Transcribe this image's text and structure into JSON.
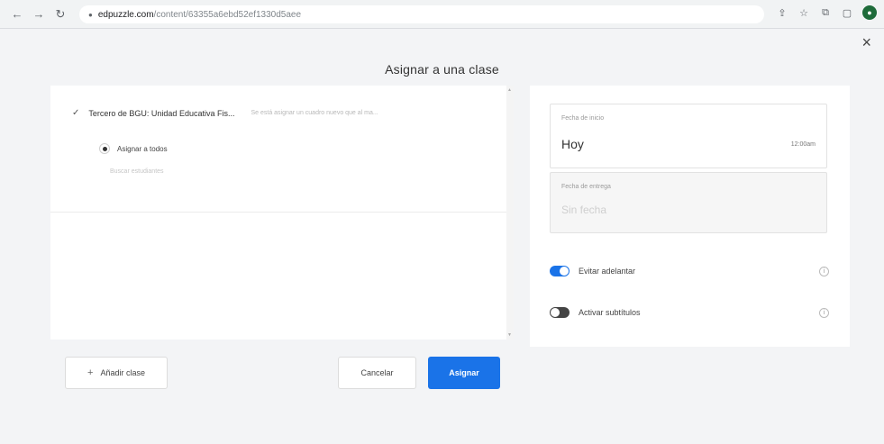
{
  "browser": {
    "address_host": "edpuzzle.com",
    "address_path": "/content/63355a6ebd52ef1330d5aee"
  },
  "icons": {
    "back": "back-arrow-icon",
    "forward": "forward-arrow-icon",
    "reload": "reload-icon",
    "lock": "lock-icon",
    "share": "share-icon",
    "star": "star-icon",
    "extensions": "extensions-icon",
    "window": "window-icon",
    "profile": "profile-icon",
    "close": "close-icon"
  },
  "modal": {
    "title": "Asignar a una clase",
    "close_label": "×"
  },
  "class_list": {
    "class_name": "Tercero de BGU: Unidad Educativa Fis...",
    "class_hint": "Se está asignar un cuadro nuevo que al ma...",
    "assign_all_label": "Asignar a todos",
    "students_placeholder": "Buscar estudiantes"
  },
  "actions": {
    "add_class_label": "Añadir clase",
    "cancel_label": "Cancelar",
    "assign_label": "Asignar"
  },
  "settings": {
    "start_label": "Fecha de inicio",
    "start_value": "Hoy",
    "start_time": "12:00am",
    "due_label": "Fecha de entrega",
    "due_value": "Sin fecha",
    "toggles": [
      {
        "label": "Evitar adelantar",
        "state": "on"
      },
      {
        "label": "Activar subtítulos",
        "state": "off"
      }
    ],
    "info_glyph": "i"
  },
  "colors": {
    "accent": "#1a73e8",
    "profile": "#1e6b3a"
  }
}
